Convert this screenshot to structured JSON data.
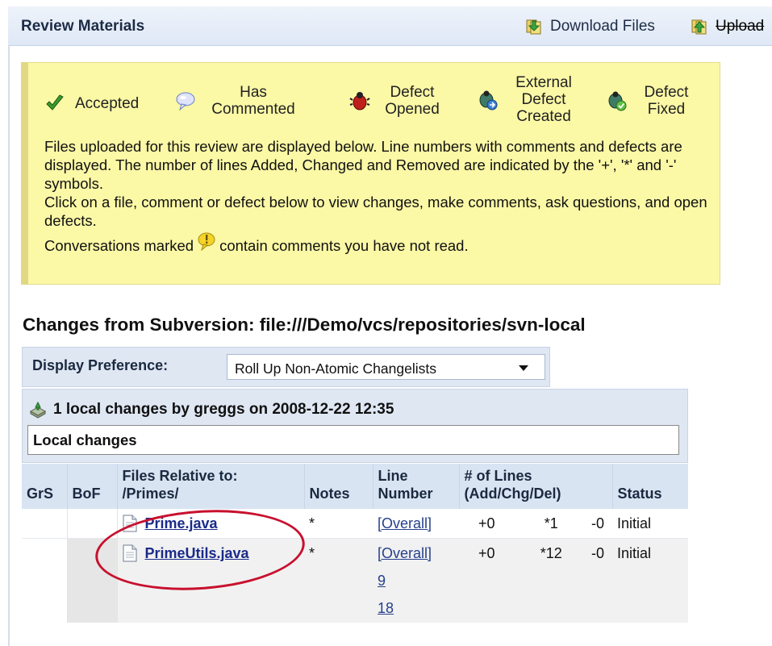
{
  "header": {
    "title": "Review Materials",
    "download_label": "Download Files",
    "upload_label": "Upload",
    "download_icon": "download-files-icon",
    "upload_icon": "upload-files-icon"
  },
  "legend": {
    "items": [
      {
        "icon": "accepted-checkmark-icon",
        "label": "Accepted"
      },
      {
        "icon": "has-commented-bubble-icon",
        "label": "Has Commented"
      },
      {
        "icon": "defect-opened-bug-icon",
        "label": "Defect Opened"
      },
      {
        "icon": "external-defect-created-icon",
        "label": "External Defect Created"
      },
      {
        "icon": "defect-fixed-icon",
        "label": "Defect Fixed"
      }
    ],
    "paragraph1": "Files uploaded for this review are displayed below. Line numbers with comments and defects are displayed. The number of lines Added, Changed and Removed are indicated by the '+', '*' and '-' symbols.",
    "paragraph2": "Click on a file, comment or defect below to view changes, make comments, ask questions, and open defects.",
    "conv_before": "Conversations marked",
    "conv_after": "contain comments you have not read.",
    "conv_icon": "unread-comment-icon"
  },
  "changes_title": "Changes from Subversion: file:///Demo/vcs/repositories/svn-local",
  "display_preference": {
    "label": "Display Preference:",
    "selected": "Roll Up Non-Atomic Changelists"
  },
  "changelist": {
    "heading": "1 local changes by greggs on 2008-12-22 12:35",
    "subheading": "Local changes",
    "icon": "changelist-icon"
  },
  "table": {
    "headers": {
      "grs": "GrS",
      "bof": "BoF",
      "files_line1": "Files Relative to:",
      "files_line2": "/Primes/",
      "notes": "Notes",
      "line_line1": "Line",
      "line_line2": "Number",
      "lines_line1": "# of Lines",
      "lines_line2": "(Add/Chg/Del)",
      "status": "Status"
    },
    "rows": [
      {
        "file": "Prime.java",
        "notes": "*",
        "line_numbers": [
          "[Overall]"
        ],
        "add": "+0",
        "chg": "*1",
        "del": "-0",
        "status": "Initial"
      },
      {
        "file": "PrimeUtils.java",
        "notes": "*",
        "line_numbers": [
          "[Overall]",
          "9",
          "18"
        ],
        "add": "+0",
        "chg": "*12",
        "del": "-0",
        "status": "Initial"
      }
    ]
  },
  "colors": {
    "legend_bg": "#fbf8a6",
    "header_bg": "#dfe8f6",
    "annotation_circle": "#c8102e",
    "link": "#1a2a8a"
  }
}
